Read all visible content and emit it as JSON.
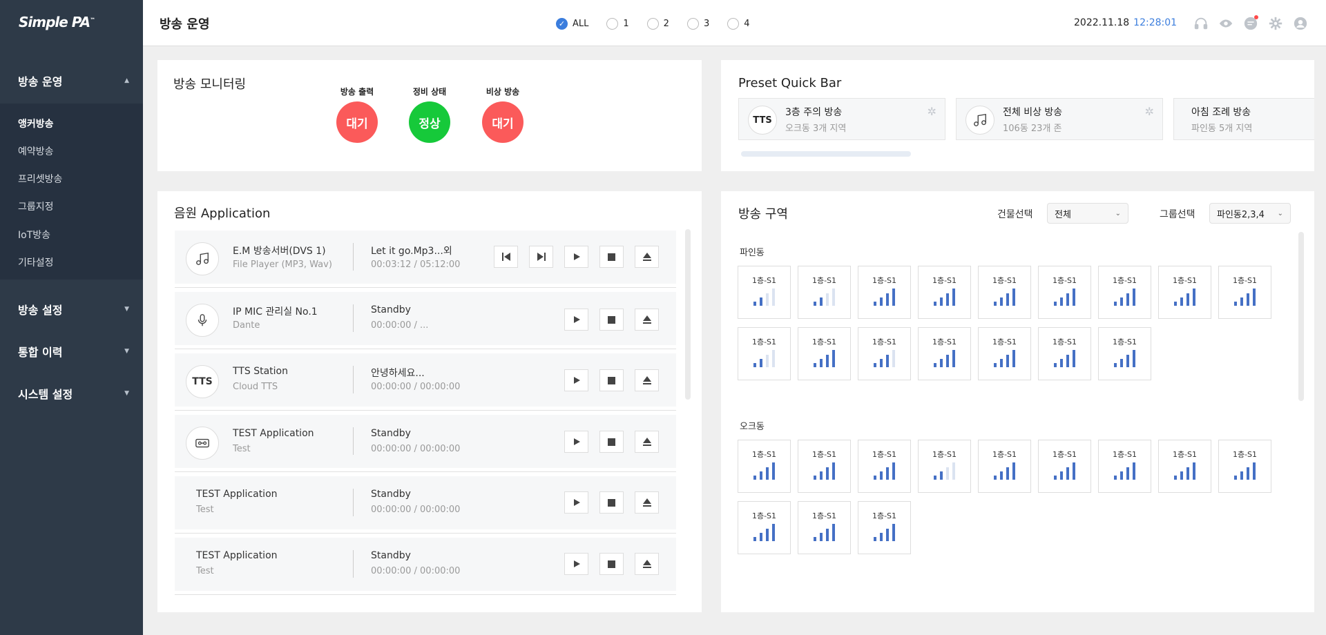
{
  "sidebar": {
    "logo": "Simple PA",
    "logo_tm": "™",
    "sections": [
      {
        "label": "방송 운영",
        "caret": "▲"
      },
      {
        "label": "방송 설정",
        "caret": "▼"
      },
      {
        "label": "통합 이력",
        "caret": "▼"
      },
      {
        "label": "시스템 설정",
        "caret": "▼"
      }
    ],
    "subitems": [
      "앵커방송",
      "예약방송",
      "프리셋방송",
      "그룹지정",
      "IoT방송",
      "기타설정"
    ]
  },
  "header": {
    "title": "방송 운영",
    "radios": [
      {
        "label": "ALL",
        "checked": true
      },
      {
        "label": "1",
        "checked": false
      },
      {
        "label": "2",
        "checked": false
      },
      {
        "label": "3",
        "checked": false
      },
      {
        "label": "4",
        "checked": false
      }
    ],
    "check_mark": "✓",
    "date": "2022.11.18",
    "time": "12:28:01",
    "icons": [
      "headset-icon",
      "eye-icon",
      "chat-icon",
      "settings-icon",
      "user-icon"
    ]
  },
  "monitoring": {
    "title": "방송 모니터링",
    "items": [
      {
        "label": "방송 출력",
        "status": "대기",
        "color": "#fb5a5a"
      },
      {
        "label": "정비 상태",
        "status": "정상",
        "color": "#16c93a"
      },
      {
        "label": "비상 방송",
        "status": "대기",
        "color": "#fb5a5a"
      }
    ]
  },
  "preset": {
    "title": "Preset Quick Bar",
    "items": [
      {
        "icon": "TTS",
        "name": "3층 주의 방송",
        "sub": "오크동 3개 지역"
      },
      {
        "icon": "music-icon",
        "name": "전체 비상 방송",
        "sub": "106동 23개 존"
      },
      {
        "icon": "",
        "name": "아침 조례 방송",
        "sub": "파인동 5개 지역"
      }
    ],
    "star": "✲"
  },
  "audio": {
    "title": "음원 Application",
    "rows": [
      {
        "icon": "music-icon",
        "name": "E.M 방송서버(DVS 1)",
        "sub": "File Player (MP3, Wav)",
        "status": "Let it go.Mp3...외",
        "time": "00:03:12 / 05:12:00"
      },
      {
        "icon": "mic-icon",
        "name": "IP MIC 관리실 No.1",
        "sub": "Dante",
        "status": "Standby",
        "time": "00:00:00 / ..."
      },
      {
        "icon": "TTS",
        "name": "TTS Station",
        "sub": "Cloud TTS",
        "status": "안녕하세요...",
        "time": "00:00:00 / 00:00:00"
      },
      {
        "icon": "tape-icon",
        "name": "TEST Application",
        "sub": "Test",
        "status": "Standby",
        "time": "00:00:00 / 00:00:00"
      },
      {
        "icon": "",
        "name": "TEST Application",
        "sub": "Test",
        "status": "Standby",
        "time": "00:00:00 / 00:00:00"
      },
      {
        "icon": "",
        "name": "TEST Application",
        "sub": "Test",
        "status": "Standby",
        "time": "00:00:00 / 00:00:00"
      }
    ]
  },
  "zones": {
    "title": "방송 구역",
    "building_label": "건물선택",
    "building_value": "전체",
    "group_label": "그룹선택",
    "group_value": "파인동2,3,4",
    "groups": [
      {
        "name": "파인동",
        "zones": [
          {
            "label": "1층-S1",
            "level": 2
          },
          {
            "label": "1층-S1",
            "level": 2
          },
          {
            "label": "1층-S1",
            "level": 4
          },
          {
            "label": "1층-S1",
            "level": 4
          },
          {
            "label": "1층-S1",
            "level": 4
          },
          {
            "label": "1층-S1",
            "level": 4
          },
          {
            "label": "1층-S1",
            "level": 4
          },
          {
            "label": "1층-S1",
            "level": 4
          },
          {
            "label": "1층-S1",
            "level": 4
          },
          {
            "label": "1층-S1",
            "level": 2
          },
          {
            "label": "1층-S1",
            "level": 4
          },
          {
            "label": "1층-S1",
            "level": 3
          },
          {
            "label": "1층-S1",
            "level": 4
          },
          {
            "label": "1층-S1",
            "level": 4
          },
          {
            "label": "1층-S1",
            "level": 4
          },
          {
            "label": "1층-S1",
            "level": 4
          }
        ]
      },
      {
        "name": "오크동",
        "zones": [
          {
            "label": "1층-S1",
            "level": 4
          },
          {
            "label": "1층-S1",
            "level": 4
          },
          {
            "label": "1층-S1",
            "level": 4
          },
          {
            "label": "1층-S1",
            "level": 2
          },
          {
            "label": "1층-S1",
            "level": 4
          },
          {
            "label": "1층-S1",
            "level": 4
          },
          {
            "label": "1층-S1",
            "level": 4
          },
          {
            "label": "1층-S1",
            "level": 4
          },
          {
            "label": "1층-S1",
            "level": 4
          },
          {
            "label": "1층-S1",
            "level": 4
          },
          {
            "label": "1층-S1",
            "level": 4
          },
          {
            "label": "1층-S1",
            "level": 4
          }
        ]
      }
    ]
  },
  "colors": {
    "accent": "#3b7ddd",
    "sidebar": "#2e3a48",
    "bar": "#4570c5"
  }
}
